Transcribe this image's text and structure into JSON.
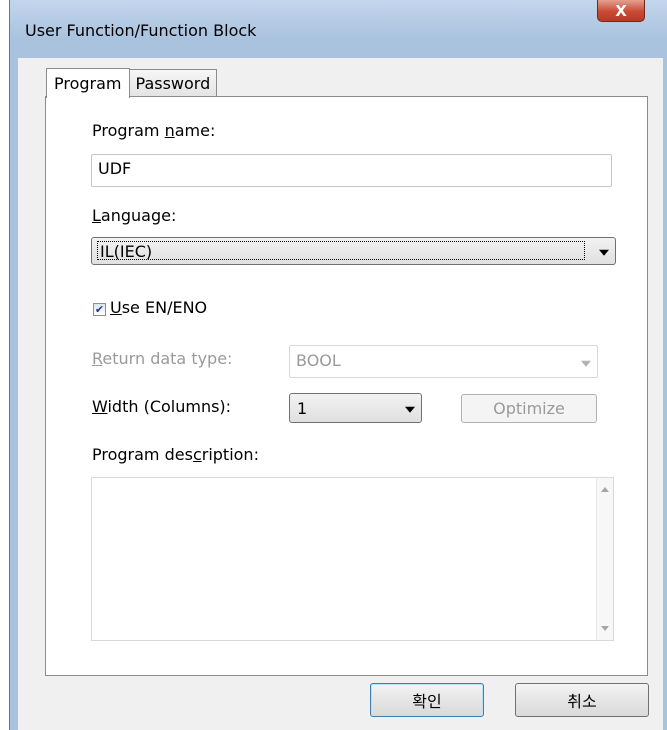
{
  "window": {
    "title": "User Function/Function Block",
    "close_glyph": "X"
  },
  "tabs": [
    {
      "label": "Program"
    },
    {
      "label": "Password"
    }
  ],
  "program_name": {
    "label_pre": "Program ",
    "label_accel": "n",
    "label_post": "ame:",
    "value": "UDF"
  },
  "language": {
    "label_accel": "L",
    "label_post": "anguage:",
    "value": "IL(IEC)"
  },
  "use_en_eno": {
    "label_accel": "U",
    "label_post": "se EN/ENO",
    "checked": true
  },
  "return_type": {
    "label_accel": "R",
    "label_post": "eturn data type:",
    "value": "BOOL"
  },
  "width": {
    "label_accel": "W",
    "label_post": "idth (Columns):",
    "value": "1"
  },
  "optimize_label": "Optimize",
  "description": {
    "label_pre": "Program des",
    "label_accel": "c",
    "label_post": "ription:",
    "value": ""
  },
  "buttons": {
    "ok": "확인",
    "cancel": "취소"
  }
}
